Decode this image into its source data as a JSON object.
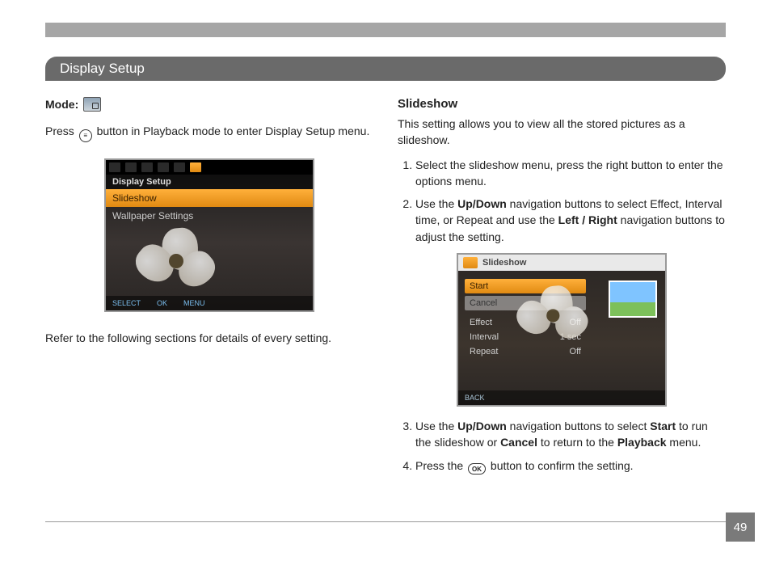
{
  "header": {
    "title": "Display Setup"
  },
  "left": {
    "mode_label": "Mode",
    "press_prefix": "Press",
    "press_suffix": "button in Playback mode to enter Display Setup menu.",
    "refer": "Refer to the following sections for details of every setting.",
    "screenshot": {
      "title": "Display Setup",
      "items": [
        "Slideshow",
        "Wallpaper Settings"
      ],
      "footer": [
        "SELECT",
        "OK",
        "MENU"
      ]
    }
  },
  "right": {
    "heading": "Slideshow",
    "desc": "This setting allows you to view all the stored pictures as a slideshow.",
    "step1": "Select the slideshow menu, press the right button to enter the options menu.",
    "step2_a": "Use the ",
    "step2_updown": "Up/Down",
    "step2_b": " navigation buttons to select Effect, Interval time, or Repeat and use the ",
    "step2_lr": "Left / Right",
    "step2_c": " navigation buttons to adjust the setting.",
    "step3_a": "Use the ",
    "step3_updown": "Up/Down",
    "step3_b": " navigation buttons to select ",
    "step3_start": "Start",
    "step3_c": " to run the slideshow or ",
    "step3_cancel": "Cancel",
    "step3_d": " to return to the ",
    "step3_playback": "Playback",
    "step3_e": " menu.",
    "step4_a": "Press the ",
    "step4_b": " button to confirm the setting.",
    "ok_label": "OK",
    "screenshot": {
      "title": "Slideshow",
      "rows": [
        {
          "label": "Start",
          "value": ""
        },
        {
          "label": "Cancel",
          "value": ""
        },
        {
          "label": "Effect",
          "value": "Off"
        },
        {
          "label": "Interval",
          "value": "1 sec"
        },
        {
          "label": "Repeat",
          "value": "Off"
        }
      ],
      "footer": "BACK"
    }
  },
  "page": {
    "number": "49"
  }
}
